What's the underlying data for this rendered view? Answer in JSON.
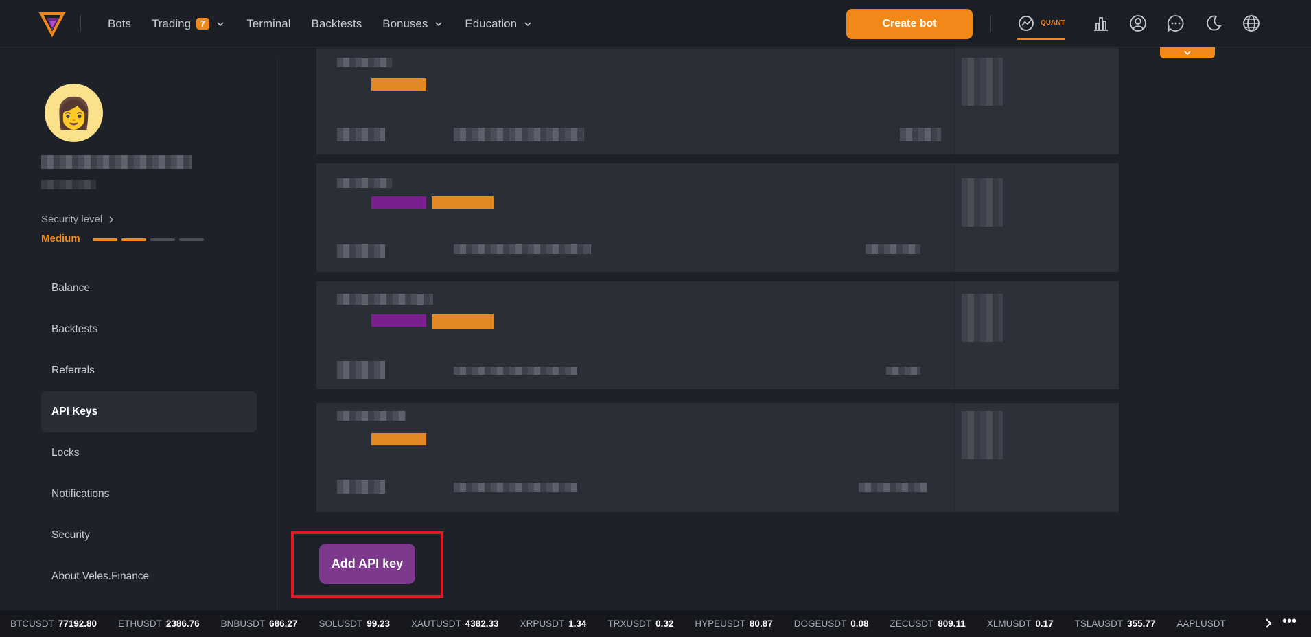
{
  "header": {
    "nav": [
      {
        "label": "Bots"
      },
      {
        "label": "Trading",
        "badge": "7"
      },
      {
        "label": "Terminal"
      },
      {
        "label": "Backtests"
      },
      {
        "label": "Bonuses"
      },
      {
        "label": "Education"
      }
    ],
    "create_bot": "Create bot",
    "quant_label": "QUANT"
  },
  "sidebar": {
    "security_level_label": "Security level",
    "security_level_value": "Medium",
    "security_level_filled": 2,
    "security_level_total": 4,
    "items": [
      {
        "label": "Balance"
      },
      {
        "label": "Backtests"
      },
      {
        "label": "Referrals"
      },
      {
        "label": "API Keys",
        "active": true
      },
      {
        "label": "Locks"
      },
      {
        "label": "Notifications"
      },
      {
        "label": "Security"
      },
      {
        "label": "About Veles.Finance"
      }
    ]
  },
  "main": {
    "add_api_key": "Add API key"
  },
  "ticker": [
    {
      "symbol": "BTCUSDT",
      "price": "77192.80"
    },
    {
      "symbol": "ETHUSDT",
      "price": "2386.76"
    },
    {
      "symbol": "BNBUSDT",
      "price": "686.27"
    },
    {
      "symbol": "SOLUSDT",
      "price": "99.23"
    },
    {
      "symbol": "XAUTUSDT",
      "price": "4382.33"
    },
    {
      "symbol": "XRPUSDT",
      "price": "1.34"
    },
    {
      "symbol": "TRXUSDT",
      "price": "0.32"
    },
    {
      "symbol": "HYPEUSDT",
      "price": "80.87"
    },
    {
      "symbol": "DOGEUSDT",
      "price": "0.08"
    },
    {
      "symbol": "ZECUSDT",
      "price": "809.11"
    },
    {
      "symbol": "XLMUSDT",
      "price": "0.17"
    },
    {
      "symbol": "TSLAUSDT",
      "price": "355.77"
    },
    {
      "symbol": "AAPLUSDT",
      "price": ""
    }
  ],
  "colors": {
    "accent": "#f0891a",
    "button_purple": "#7d3a8c",
    "highlight_red": "#e01b24"
  }
}
